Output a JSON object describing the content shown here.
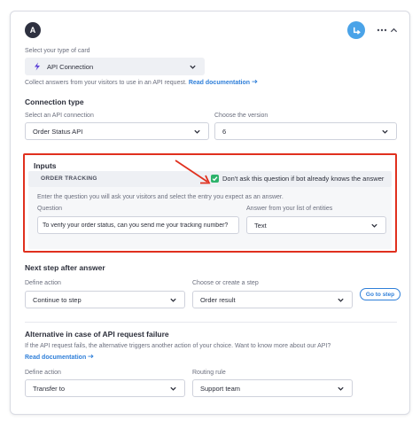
{
  "header": {
    "avatar_letter": "A",
    "route_icon": "route-arrow-icon",
    "more_icon": "more-horizontal-icon",
    "collapse_icon": "chevron-up-icon"
  },
  "card_type": {
    "label": "Select your type of card",
    "value": "API Connection",
    "icon": "lightning-bolt-icon",
    "helper": "Collect answers from your visitors to use in an API request.",
    "doc_link": "Read documentation"
  },
  "connection": {
    "title": "Connection type",
    "api_label": "Select an API connection",
    "api_value": "Order Status API",
    "version_label": "Choose the version",
    "version_value": "6"
  },
  "inputs": {
    "title": "Inputs",
    "order_label": "ORDER TRACKING",
    "checkbox_label": "Don't ask this question if bot already knows the answer",
    "checkbox_checked": true,
    "instructions": "Enter the question you will ask your visitors and select the entry you expect as an answer.",
    "question_label": "Question",
    "question_value": "To verify your order status, can you send me your tracking number?",
    "answer_label": "Answer from your list of entities",
    "answer_value": "Text"
  },
  "next_step": {
    "title": "Next step after answer",
    "action_label": "Define action",
    "action_value": "Continue to step",
    "step_label": "Choose or create a step",
    "step_value": "Order result",
    "goto_button": "Go to step"
  },
  "failure": {
    "title": "Alternative in case of API request failure",
    "helper": "If the API request fails, the alternative triggers another action of your choice. Want to know more about our API?",
    "doc_link": "Read documentation",
    "action_label": "Define action",
    "action_value": "Transfer to",
    "routing_label": "Routing rule",
    "routing_value": "Support team"
  },
  "colors": {
    "accent": "#2f7fd9",
    "highlight": "#e0301e",
    "check": "#2db36b"
  }
}
